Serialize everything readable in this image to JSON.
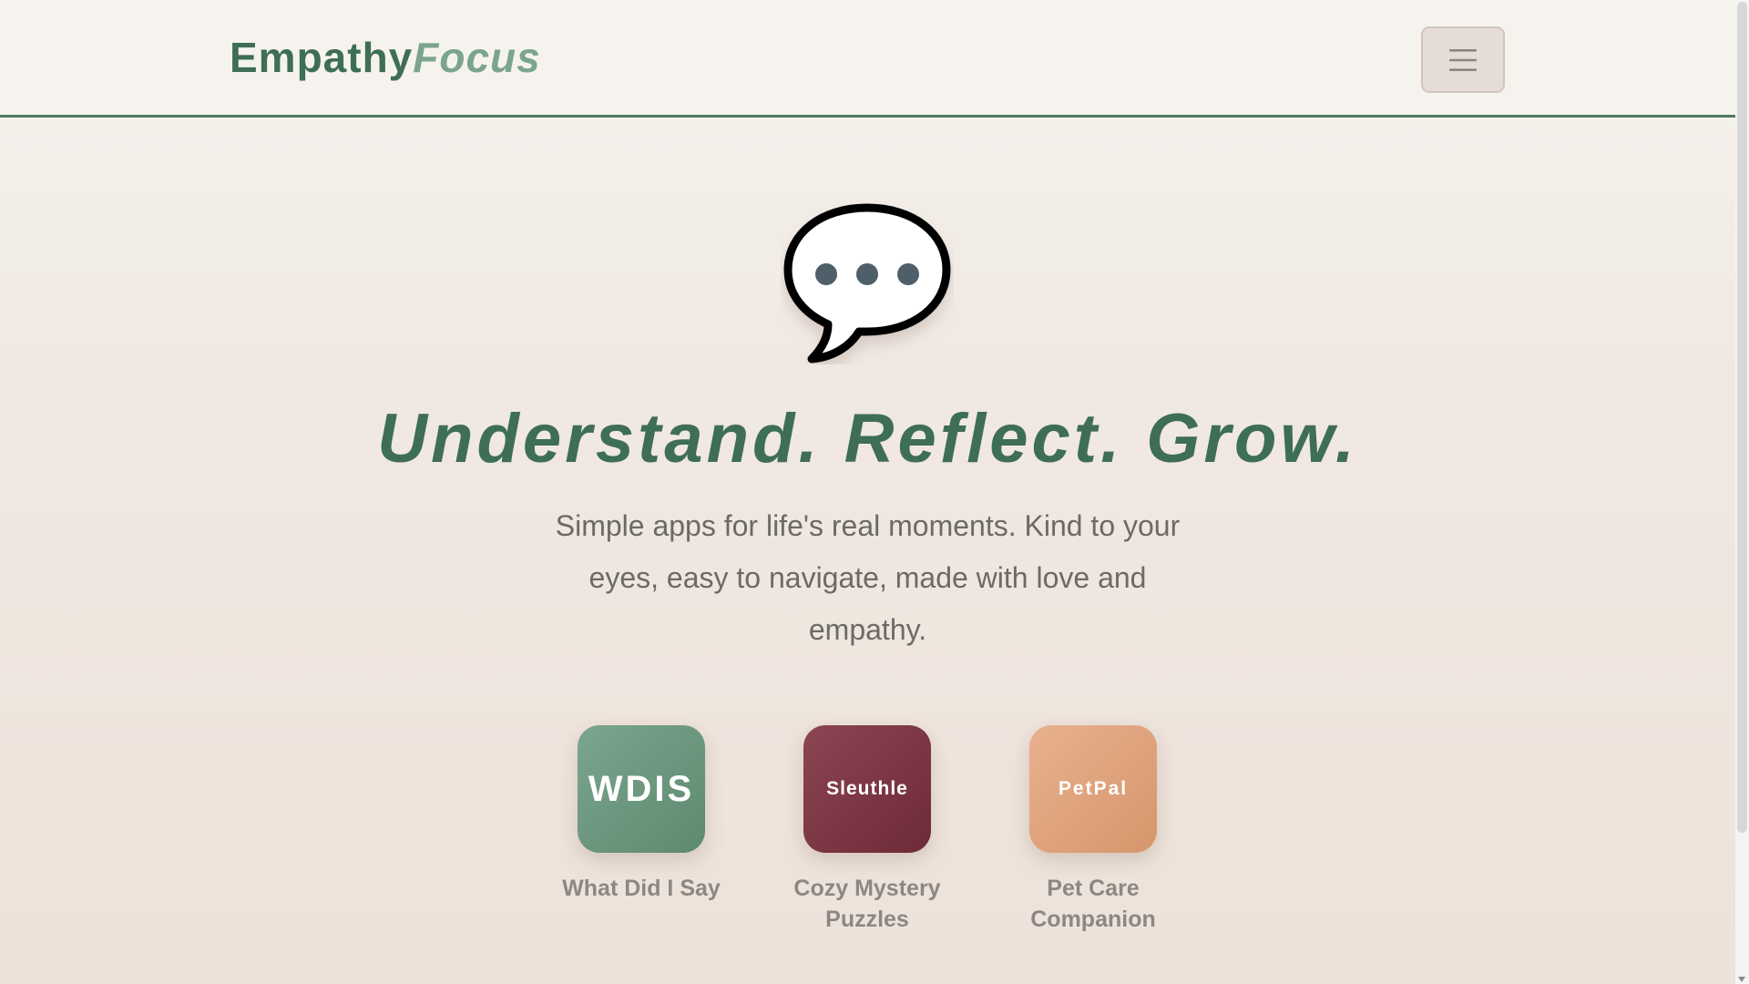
{
  "header": {
    "logo_part1": "Empathy",
    "logo_part2": "Focus",
    "menu_icon": "hamburger-menu-icon"
  },
  "hero": {
    "icon": "speech-bubble-icon",
    "title": "Understand. Reflect. Grow.",
    "subtitle": "Simple apps for life's real moments. Kind to your eyes, easy to navigate, made with love and empathy."
  },
  "apps": [
    {
      "tile_label": "WDIS",
      "name": "What Did I Say",
      "color": "#6a9a7e"
    },
    {
      "tile_label": "Sleuthle",
      "name": "Cozy Mystery Puzzles",
      "color": "#7a3541"
    },
    {
      "tile_label": "PetPal",
      "name": "Pet Care Companion",
      "color": "#df a37d"
    }
  ],
  "colors": {
    "brand_green": "#3e6e55",
    "brand_green_light": "#7ba58b",
    "background": "#f6f3ee",
    "text_muted": "#6b6a67"
  }
}
